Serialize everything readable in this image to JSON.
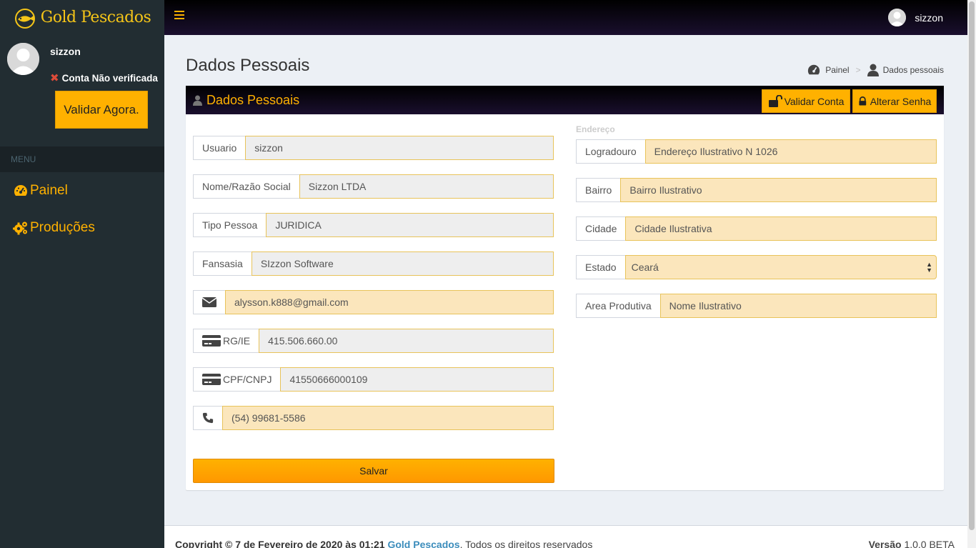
{
  "app": {
    "brand": "Gold Pescados",
    "brand_color": "#ffb100",
    "sidebar_color": "#222d32"
  },
  "sidebar": {
    "user_name": "sizzon",
    "status_text": "Conta Não verificada",
    "validate_label": "Validar Agora.",
    "menu_header": "MENU",
    "items": [
      {
        "label": "Painel",
        "icon": "dashboard-icon"
      },
      {
        "label": "Produções",
        "icon": "cogs-icon"
      }
    ]
  },
  "topbar": {
    "user_name": "sizzon"
  },
  "page": {
    "title": "Dados Pessoais",
    "breadcrumb": [
      "Painel",
      "Dados pessoais"
    ]
  },
  "box": {
    "title": "Dados Pessoais",
    "validate_account_label": "Validar Conta",
    "change_password_label": "Alterar Senha"
  },
  "form": {
    "usuario_label": "Usuario",
    "usuario_value": "sizzon",
    "nome_label": "Nome/Razão Social",
    "nome_value": "Sizzon LTDA",
    "tipo_label": "Tipo Pessoa",
    "tipo_value": "JURIDICA",
    "fantasia_label": "Fansasia",
    "fantasia_value": "SIzzon Software",
    "email_value": "alysson.k888@gmail.com",
    "rg_label": "RG/IE",
    "rg_value": "415.506.660.00",
    "cpf_label": "CPF/CNPJ",
    "cpf_value": "41550666000109",
    "phone_value": "(54) 99681-5586",
    "save_label": "Salvar"
  },
  "address": {
    "section_label": "Endereço",
    "logradouro_label": "Logradouro",
    "logradouro_value": "Endereço Ilustrativo N 1026",
    "bairro_label": "Bairro",
    "bairro_value": "Bairro Ilustrativo",
    "cidade_label": "Cidade",
    "cidade_value": "Cidade Ilustrativa",
    "estado_label": "Estado",
    "estado_value": "Ceará",
    "area_label": "Area Produtiva",
    "area_value": "Nome Ilustrativo"
  },
  "footer": {
    "copyright_prefix": "Copyright © 7 de Fevereiro de 2020 às 01:21",
    "brand_link": "Gold Pescados",
    "rights": ". Todos os direitos reservados",
    "version_label": "Versão",
    "version_value": "1.0.0 BETA"
  }
}
